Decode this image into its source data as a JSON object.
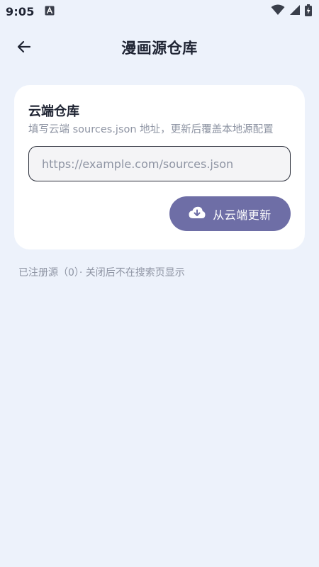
{
  "status_bar": {
    "time": "9:05",
    "icons": [
      "accessibility-a-icon",
      "wifi-icon",
      "signal-icon",
      "battery-charging-icon"
    ]
  },
  "app_bar": {
    "back_icon": "arrow-left-icon",
    "title": "漫画源仓库"
  },
  "cloud_repo": {
    "title": "云端仓库",
    "subtitle": "填写云端 sources.json 地址，更新后覆盖本地源配置",
    "url_input": {
      "value": "",
      "placeholder": "https://example.com/sources.json"
    },
    "update_button": {
      "icon": "cloud-download-icon",
      "label": "从云端更新"
    }
  },
  "registered_note": "已注册源（0）· 关闭后不在搜索页显示",
  "colors": {
    "background": "#EDF2FB",
    "card": "#FFFFFF",
    "accent": "#6E6EA6",
    "muted_text": "#8E94A3",
    "primary_text": "#1F2433"
  }
}
